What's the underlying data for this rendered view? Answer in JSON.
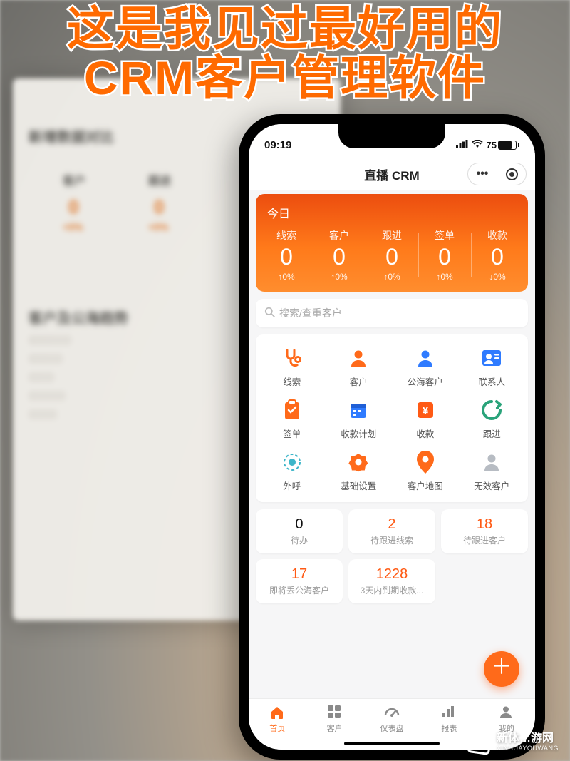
{
  "headline": "这是我见过最好用的\nCRM客户管理软件",
  "statusbar": {
    "time": "09:19",
    "battery": "75"
  },
  "titlebar": {
    "title": "直播 CRM"
  },
  "orange": {
    "today": "今日",
    "stats": [
      {
        "label": "线索",
        "value": "0",
        "delta": "↑0%"
      },
      {
        "label": "客户",
        "value": "0",
        "delta": "↑0%"
      },
      {
        "label": "跟进",
        "value": "0",
        "delta": "↑0%"
      },
      {
        "label": "签单",
        "value": "0",
        "delta": "↑0%"
      },
      {
        "label": "收款",
        "value": "0",
        "delta": "↓0%"
      }
    ]
  },
  "search": {
    "placeholder": "搜索/查重客户"
  },
  "modules": [
    {
      "name": "leads",
      "label": "线索",
      "icon": "stethoscope",
      "color": "#ff6a1a"
    },
    {
      "name": "customers",
      "label": "客户",
      "icon": "person",
      "color": "#ff6a1a"
    },
    {
      "name": "sea",
      "label": "公海客户",
      "icon": "person",
      "color": "#2f7bff"
    },
    {
      "name": "contacts",
      "label": "联系人",
      "icon": "contact",
      "color": "#2f7bff"
    },
    {
      "name": "orders",
      "label": "签单",
      "icon": "clipboard",
      "color": "#ff6a1a"
    },
    {
      "name": "payplan",
      "label": "收款计划",
      "icon": "calendar",
      "color": "#2f7bff"
    },
    {
      "name": "payment",
      "label": "收款",
      "icon": "yen",
      "color": "#ff5a14"
    },
    {
      "name": "follow",
      "label": "跟进",
      "icon": "swirl",
      "color": "#2aa37a"
    },
    {
      "name": "call",
      "label": "外呼",
      "icon": "dialring",
      "color": "#3db6c9"
    },
    {
      "name": "settings",
      "label": "基础设置",
      "icon": "gear",
      "color": "#ff6a1a"
    },
    {
      "name": "map",
      "label": "客户地图",
      "icon": "pin",
      "color": "#ff6a1a"
    },
    {
      "name": "invalid",
      "label": "无效客户",
      "icon": "person",
      "color": "#b7bcc3"
    }
  ],
  "tiles": [
    {
      "name": "todo",
      "num": "0",
      "accent": false,
      "label": "待办"
    },
    {
      "name": "leads-due",
      "num": "2",
      "accent": true,
      "label": "待跟进线索"
    },
    {
      "name": "cust-due",
      "num": "18",
      "accent": true,
      "label": "待跟进客户"
    },
    {
      "name": "sea-soon",
      "num": "17",
      "accent": true,
      "label": "即将丢公海客户"
    },
    {
      "name": "pay-3d",
      "num": "1228",
      "accent": true,
      "label": "3天内到期收款..."
    }
  ],
  "tabs": [
    {
      "name": "home",
      "label": "首页",
      "icon": "house",
      "active": true
    },
    {
      "name": "customers",
      "label": "客户",
      "icon": "grid",
      "active": false
    },
    {
      "name": "dashboard",
      "label": "仪表盘",
      "icon": "gauge",
      "active": false
    },
    {
      "name": "reports",
      "label": "报表",
      "icon": "chart",
      "active": false
    },
    {
      "name": "me",
      "label": "我的",
      "icon": "user",
      "active": false
    }
  ],
  "watermark": {
    "line1": "新体…游网",
    "line2": "XINHUAYOUWANG"
  },
  "background": {
    "heading1": "新增数据对比",
    "col1": "客户",
    "col2": "跟进",
    "val": "0",
    "pct": "+0%",
    "heading2": "客户及公海趋势"
  }
}
